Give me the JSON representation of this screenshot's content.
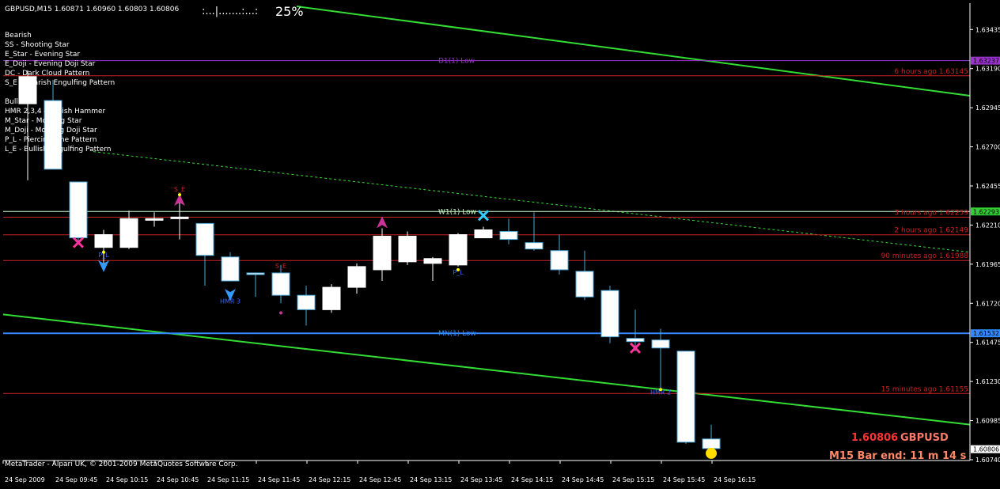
{
  "header": {
    "symbol_line": "GBPUSD,M15  1.60871 1.60960 1.60803 1.60806",
    "spread_bar": ":...|.......:...:",
    "spread_pct": "25%"
  },
  "legend": {
    "bearish_title": "Bearish",
    "bearish": [
      "SS - Shooting Star",
      "E_Star - Evening Star",
      "E_Doji - Evening Doji Star",
      "DC - Dark Cloud Pattern",
      "S_E - Bearish Engulfing Pattern"
    ],
    "bullish_title": "Bullish",
    "bullish": [
      "HMR 2,3,4 - Bullish Hammer",
      "M_Star - Morning Star",
      "M_Doji - Morning Doji Star",
      "P_L - Piercing Line Pattern",
      "L_E - Bullish Engulfing Pattern"
    ]
  },
  "footer": {
    "copyright": "MetaTrader - Alpari UK, © 2001-2009 MetaQuotes Software Corp.",
    "price_big": "1.60806",
    "symbol_big": "GBPUSD",
    "bar_end": "M15 Bar end: 11 m 14 s"
  },
  "colors": {
    "background": "#000000",
    "bull_candle": "#ffffff",
    "bear_candle_border": "#4aa8d8",
    "channel": "#33dd33",
    "mn_low": "#3388ff",
    "d1_low": "#9933cc",
    "recent_line": "#cc2222",
    "w1_line": "#ccffcc"
  },
  "chart_data": {
    "type": "candlestick",
    "title": "GBPUSD,M15",
    "ylim": [
      1.60735,
      1.636
    ],
    "y_ticks": [
      "1.63435",
      "1.63190",
      "1.62945",
      "1.62700",
      "1.62455",
      "1.62210",
      "1.61965",
      "1.61720",
      "1.61475",
      "1.61230",
      "1.60985",
      "1.60740"
    ],
    "y_tick_labels": [
      "1.63435",
      "1.63190",
      "1.62945",
      "1.62700",
      "1.62455",
      "1.62210",
      "1.61965",
      "1.61720",
      "1.61475",
      "1.61230",
      "1.60985",
      "1.60740"
    ],
    "x_tick_labels": [
      "24 Sep 2009",
      "24 Sep 09:45",
      "24 Sep 10:15",
      "24 Sep 10:45",
      "24 Sep 11:15",
      "24 Sep 11:45",
      "24 Sep 12:15",
      "24 Sep 12:45",
      "24 Sep 13:15",
      "24 Sep 13:45",
      "24 Sep 14:15",
      "24 Sep 14:45",
      "24 Sep 15:15",
      "24 Sep 15:45",
      "24 Sep 16:15"
    ],
    "candles": [
      {
        "o": 1.6297,
        "h": 1.6318,
        "l": 1.6249,
        "c": 1.6314
      },
      {
        "o": 1.6299,
        "h": 1.6312,
        "l": 1.6263,
        "c": 1.6256
      },
      {
        "o": 1.6248,
        "h": 1.6248,
        "l": 1.6211,
        "c": 1.6213
      },
      {
        "o": 1.6207,
        "h": 1.6218,
        "l": 1.6194,
        "c": 1.6215
      },
      {
        "o": 1.6207,
        "h": 1.623,
        "l": 1.6206,
        "c": 1.6225
      },
      {
        "o": 1.6225,
        "h": 1.6229,
        "l": 1.622,
        "c": 1.6225
      },
      {
        "o": 1.6225,
        "h": 1.6239,
        "l": 1.6212,
        "c": 1.6226
      },
      {
        "o": 1.6222,
        "h": 1.6222,
        "l": 1.6183,
        "c": 1.6202
      },
      {
        "o": 1.6201,
        "h": 1.6204,
        "l": 1.6187,
        "c": 1.6186
      },
      {
        "o": 1.6191,
        "h": 1.6191,
        "l": 1.6176,
        "c": 1.619
      },
      {
        "o": 1.6191,
        "h": 1.6196,
        "l": 1.6172,
        "c": 1.6177
      },
      {
        "o": 1.6177,
        "h": 1.6183,
        "l": 1.6158,
        "c": 1.6168
      },
      {
        "o": 1.6168,
        "h": 1.6184,
        "l": 1.6166,
        "c": 1.6182
      },
      {
        "o": 1.6182,
        "h": 1.6197,
        "l": 1.6178,
        "c": 1.6195
      },
      {
        "o": 1.6193,
        "h": 1.6219,
        "l": 1.6186,
        "c": 1.6214
      },
      {
        "o": 1.6198,
        "h": 1.6217,
        "l": 1.6196,
        "c": 1.6214
      },
      {
        "o": 1.6197,
        "h": 1.6201,
        "l": 1.6186,
        "c": 1.62
      },
      {
        "o": 1.6196,
        "h": 1.6216,
        "l": 1.6195,
        "c": 1.6215
      },
      {
        "o": 1.6213,
        "h": 1.622,
        "l": 1.6213,
        "c": 1.6218
      },
      {
        "o": 1.6217,
        "h": 1.6225,
        "l": 1.6209,
        "c": 1.6212
      },
      {
        "o": 1.621,
        "h": 1.6229,
        "l": 1.6205,
        "c": 1.6206
      },
      {
        "o": 1.6205,
        "h": 1.6215,
        "l": 1.619,
        "c": 1.6193
      },
      {
        "o": 1.6192,
        "h": 1.6205,
        "l": 1.6174,
        "c": 1.6176
      },
      {
        "o": 1.618,
        "h": 1.6183,
        "l": 1.6147,
        "c": 1.6151
      },
      {
        "o": 1.615,
        "h": 1.6168,
        "l": 1.6142,
        "c": 1.6148
      },
      {
        "o": 1.6149,
        "h": 1.6156,
        "l": 1.6119,
        "c": 1.6144
      },
      {
        "o": 1.6142,
        "h": 1.6142,
        "l": 1.6084,
        "c": 1.6085
      },
      {
        "o": 1.6087,
        "h": 1.6096,
        "l": 1.608,
        "c": 1.6081
      }
    ],
    "level_lines": [
      {
        "name": "D1(1) Low",
        "price": 1.6324,
        "color": "#9933cc",
        "label_pos": "center"
      },
      {
        "name": "6 hours ago 1.63145",
        "price": 1.63145,
        "color": "#cc2222",
        "label_pos": "right"
      },
      {
        "name": "W1(1) Low",
        "price": 1.62295,
        "color": "#ccffcc",
        "label_pos": "center"
      },
      {
        "name": "3 hours ago 1.62259",
        "price": 1.62259,
        "color": "#cc2222",
        "label_pos": "right"
      },
      {
        "name": "2 hours ago 1.62149",
        "price": 1.62149,
        "color": "#cc2222",
        "label_pos": "right"
      },
      {
        "name": "90 minutes ago 1.61988",
        "price": 1.61988,
        "color": "#cc2222",
        "label_pos": "right"
      },
      {
        "name": "MN(1) Low",
        "price": 1.61532,
        "color": "#3388ff",
        "label_pos": "center"
      },
      {
        "name": "15 minutes ago 1.61155",
        "price": 1.61155,
        "color": "#cc2222",
        "label_pos": "right"
      }
    ],
    "price_badges": [
      {
        "label": "1.63237",
        "price": 1.6324,
        "color": "#9933cc"
      },
      {
        "label": "1.62293",
        "price": 1.62295,
        "color": "#33cc33"
      },
      {
        "label": "1.61532",
        "price": 1.61532,
        "color": "#3388ff"
      },
      {
        "label": "1.60806",
        "price": 1.60806,
        "color": "#ffffff"
      }
    ],
    "pattern_labels": [
      {
        "text": "P_L",
        "candle": 3,
        "price": 1.6201,
        "color": "#3366ff"
      },
      {
        "text": "S_E",
        "candle": 6,
        "price": 1.6242,
        "color": "#cc2222"
      },
      {
        "text": "HMR 3",
        "candle": 8,
        "price": 1.6172,
        "color": "#3366ff"
      },
      {
        "text": "S_E",
        "candle": 10,
        "price": 1.6194,
        "color": "#cc2222"
      },
      {
        "text": "P_L",
        "candle": 17,
        "price": 1.619,
        "color": "#3366ff"
      },
      {
        "text": "HMR 2",
        "candle": 25,
        "price": 1.6115,
        "color": "#3366ff"
      }
    ]
  }
}
